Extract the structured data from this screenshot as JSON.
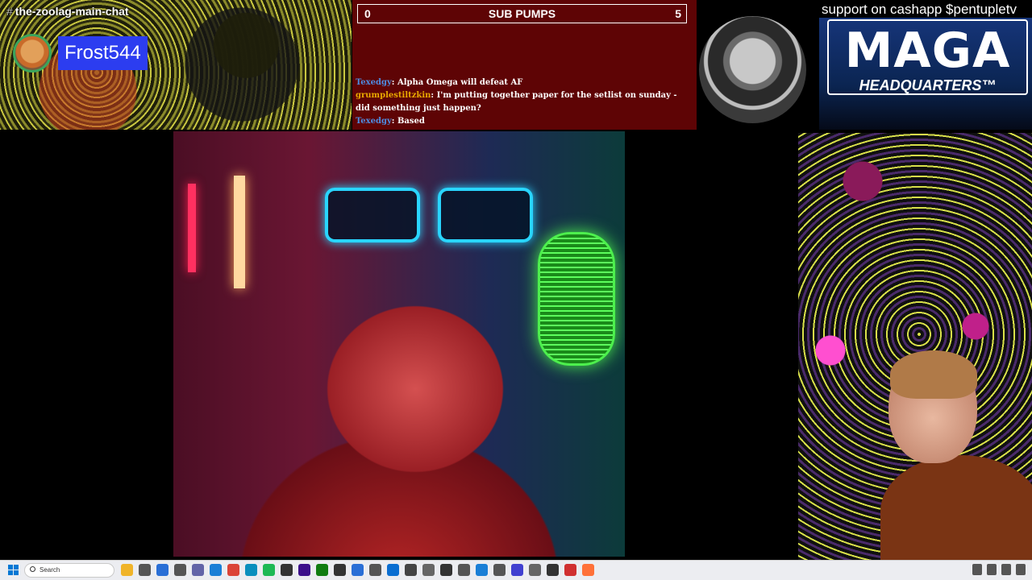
{
  "discord": {
    "channel": "the-zoolag-main-chat",
    "hash": "#",
    "username": "Frost544"
  },
  "sub_pumps": {
    "left_count": "0",
    "title": "SUB PUMPS",
    "right_count": "5"
  },
  "chat": [
    {
      "user": "Texedgy",
      "sep": ": ",
      "message": "Alpha Omega will defeat AF"
    },
    {
      "user": "grumplestiltzkin",
      "sep": ": ",
      "message": "I'm putting together paper for the setlist on sunday - did something just happen?"
    },
    {
      "user": "Texedgy",
      "sep": ": ",
      "message": "Based"
    }
  ],
  "cashapp": "support on cashapp $pentupletv",
  "maga": {
    "title": "MAGA",
    "subtitle": "HEADQUARTERS™"
  },
  "taskbar": {
    "search_label": "Search",
    "apps": [
      "file-explorer-icon",
      "settings-icon",
      "store-icon",
      "camera-icon",
      "teams-icon",
      "browser-icon",
      "chrome-icon",
      "edge-icon",
      "spotify-icon",
      "obs-icon",
      "premiere-icon",
      "xbox-icon",
      "terminal-icon",
      "notepad-icon",
      "app-icon",
      "app-icon",
      "app-icon",
      "app-icon",
      "app-icon",
      "app-icon",
      "app-icon",
      "app-icon",
      "app-icon",
      "app-icon",
      "app-icon",
      "app-icon",
      "firefox-icon"
    ],
    "colors": [
      "#f0b429",
      "#555",
      "#2a6fd6",
      "#555",
      "#6264a7",
      "#1a7fd6",
      "#db4437",
      "#0a8fbd",
      "#1db954",
      "#333",
      "#3b0f8a",
      "#107c10",
      "#333",
      "#2a6fd6",
      "#555",
      "#0a6ed1",
      "#444",
      "#666",
      "#333",
      "#555",
      "#1a7fd6",
      "#555",
      "#4040d0",
      "#666",
      "#333",
      "#d03030",
      "#ff7139"
    ]
  },
  "colors": {
    "chat_user_blue": "#4e8be0",
    "chat_user_gold": "#e8a900",
    "sub_panel_bg": "#5e0405",
    "username_bg": "#2c3df0"
  }
}
